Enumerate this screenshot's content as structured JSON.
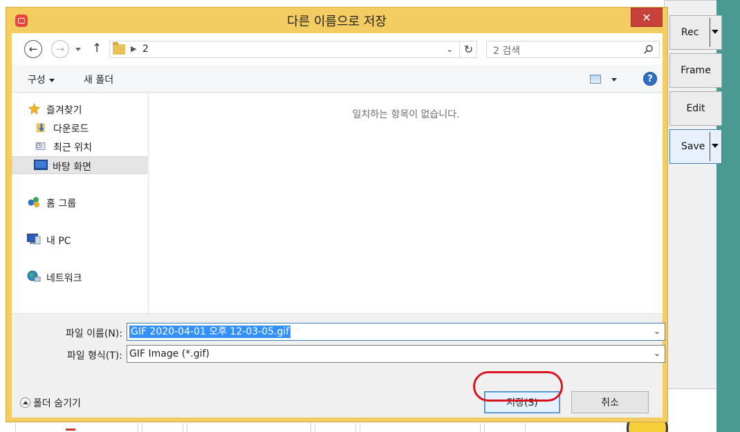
{
  "background_app": {
    "buttons": [
      {
        "label": "Rec",
        "has_dropdown": true
      },
      {
        "label": "Frame",
        "has_dropdown": false
      },
      {
        "label": "Edit",
        "has_dropdown": false
      },
      {
        "label": "Save",
        "has_dropdown": true
      }
    ]
  },
  "dialog": {
    "title": "다른 이름으로 저장",
    "close_label": "✕",
    "nav": {
      "back_icon": "back-arrow-icon",
      "forward_icon": "forward-arrow-icon",
      "up_icon": "up-arrow-icon",
      "path": "2",
      "search_placeholder": "2 검색"
    },
    "toolbar": {
      "organize_label": "구성",
      "new_folder_label": "새 폴더",
      "help_label": "?"
    },
    "nav_pane": {
      "favorites_label": "즐겨찾기",
      "favorites": [
        "다운로드",
        "최근 위치",
        "바탕 화면"
      ],
      "selected": "바탕 화면",
      "homegroup_label": "홈 그룹",
      "pc_label": "내 PC",
      "network_label": "네트워크"
    },
    "empty_message": "일치하는 항목이 없습니다.",
    "filename_label": "파일 이름(N):",
    "filename_value": "GIF 2020-04-01 오후 12-03-05.gif",
    "filetype_label": "파일 형식(T):",
    "filetype_value": "GIF Image (*.gif)",
    "hide_folders_label": "폴더 숨기기",
    "save_label": "저장(S)",
    "cancel_label": "취소",
    "colors": {
      "frame": "#f3cc62",
      "close": "#c7413b",
      "selection": "#3390ff",
      "highlight": "#d9131f"
    }
  }
}
